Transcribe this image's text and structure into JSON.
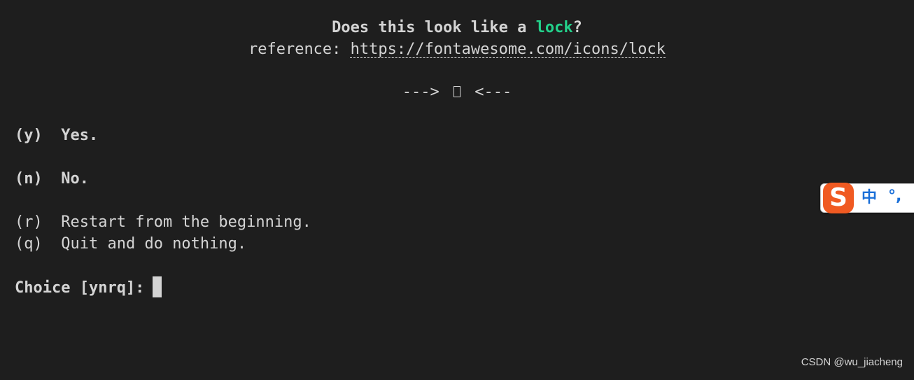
{
  "prompt": {
    "title_prefix": "Does this look like a ",
    "title_icon_name": "lock",
    "title_suffix": "?",
    "reference_label": "reference: ",
    "reference_url": "https://fontawesome.com/icons/lock"
  },
  "preview": {
    "left_arrow": "--->",
    "glyph": "lock-icon (unrendered glyph)",
    "right_arrow": "<---"
  },
  "options": [
    {
      "key": "(y)",
      "label": "Yes."
    },
    {
      "key": "(n)",
      "label": "No."
    },
    {
      "key": "(r)",
      "label": "Restart from the beginning."
    },
    {
      "key": "(q)",
      "label": "Quit and do nothing."
    }
  ],
  "input": {
    "prompt": "Choice [ynrq]:",
    "value": ""
  },
  "ime": {
    "mode": "中",
    "punct": "°,"
  },
  "watermark": "CSDN @wu_jiacheng",
  "colors": {
    "background": "#1e1e1e",
    "text": "#d4d4d4",
    "accent": "#23d18b",
    "ime_brand": "#f05a22",
    "ime_text": "#1a6fd8"
  }
}
